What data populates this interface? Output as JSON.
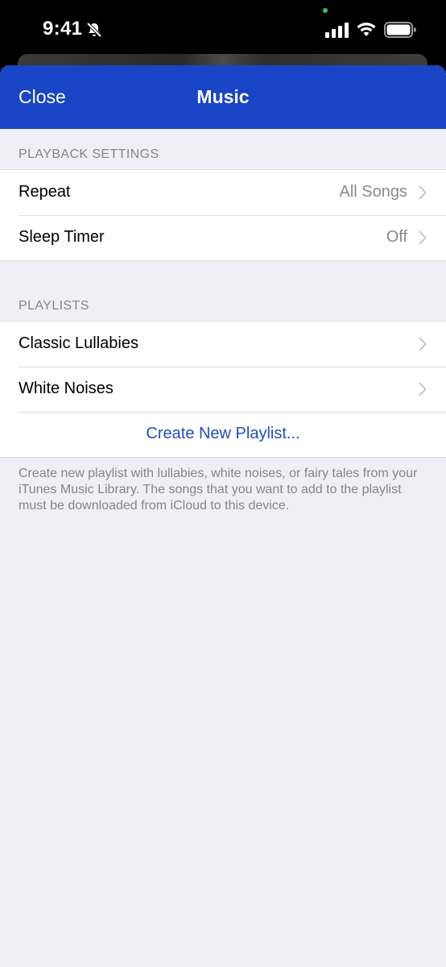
{
  "status_bar": {
    "time": "9:41",
    "icons": [
      "bell-slash-icon",
      "signal-icon",
      "wifi-icon",
      "battery-icon"
    ]
  },
  "nav": {
    "close_label": "Close",
    "title": "Music",
    "background_color": "#1745c5"
  },
  "playback": {
    "header": "PLAYBACK SETTINGS",
    "rows": [
      {
        "label": "Repeat",
        "value": "All Songs"
      },
      {
        "label": "Sleep Timer",
        "value": "Off"
      }
    ]
  },
  "playlists": {
    "header": "PLAYLISTS",
    "rows": [
      {
        "label": "Classic Lullabies"
      },
      {
        "label": "White Noises"
      }
    ],
    "create_label": "Create New Playlist...",
    "footer": "Create new playlist with lullabies, white noises, or fairy tales from your iTunes Music Library. The songs that you want to add to the playlist must be downloaded from iCloud to this device."
  },
  "colors": {
    "accent": "#1f4fbf",
    "group_background": "#f0eff5",
    "secondary_text": "#8a8a8e"
  }
}
